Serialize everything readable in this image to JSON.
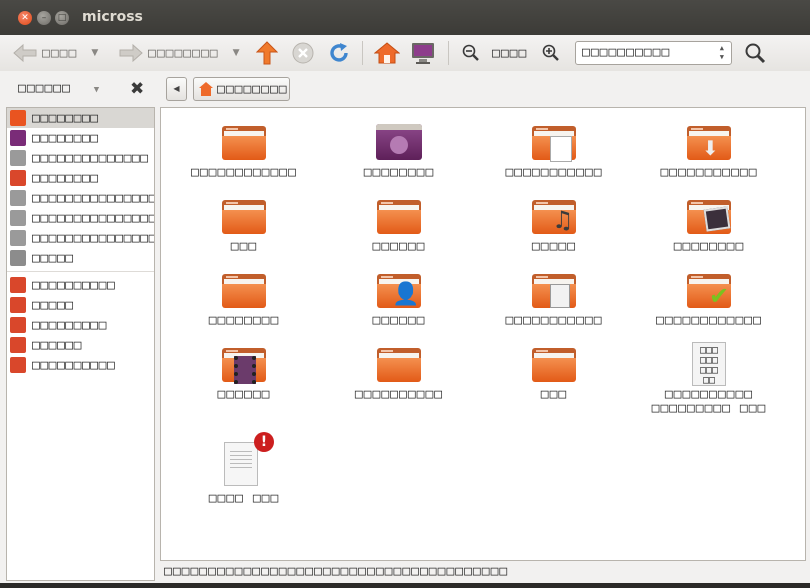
{
  "window": {
    "title": "micross"
  },
  "toolbar": {
    "back_label": "□□□□",
    "forward_label": "□□□□□□□□",
    "zoom_value": "□□□□",
    "view_mode": "□□□□□□□□□□"
  },
  "location": {
    "pane_label": "□□□□□□",
    "breadcrumb_label": "□□□□□□□□"
  },
  "sidebar": {
    "items": [
      {
        "label": "□□□□□□□□",
        "icon": "home-icon",
        "color": "#e95420"
      },
      {
        "label": "□□□□□□□□",
        "icon": "desktop-icon",
        "color": "#7a2c78"
      },
      {
        "label": "□□□□□□□□□□□□□□",
        "icon": "drive-icon",
        "color": "#9a9a9a"
      },
      {
        "label": "□□□□□□□□",
        "icon": "camera-icon",
        "color": "#d9472b"
      },
      {
        "label": "□□□□□□□□□□□□□□□",
        "icon": "drive-icon",
        "color": "#9a9a9a"
      },
      {
        "label": "□□□□□□□□□□□□□□□",
        "icon": "drive-icon",
        "color": "#9a9a9a"
      },
      {
        "label": "□□□□□□□□□□□□□□□",
        "icon": "drive-icon",
        "color": "#9a9a9a"
      },
      {
        "label": "□□□□□",
        "icon": "trash-icon",
        "color": "#8c8c8c"
      }
    ],
    "bookmarks": [
      {
        "label": "□□□□□□□□□□",
        "icon": "documents-icon",
        "color": "#d9472b"
      },
      {
        "label": "□□□□□",
        "icon": "music-icon",
        "color": "#d9472b"
      },
      {
        "label": "□□□□□□□□□",
        "icon": "pictures-icon",
        "color": "#d9472b"
      },
      {
        "label": "□□□□□□",
        "icon": "videos-icon",
        "color": "#d9472b"
      },
      {
        "label": "□□□□□□□□□□",
        "icon": "downloads-icon",
        "color": "#d9472b"
      }
    ]
  },
  "files": [
    {
      "label": "□□□□□□□□□□□□",
      "icon": "folder-icon"
    },
    {
      "label": "□□□□□□□□",
      "icon": "desktop-folder-icon"
    },
    {
      "label": "□□□□□□□□□□□",
      "icon": "documents-folder-icon"
    },
    {
      "label": "□□□□□□□□□□□",
      "icon": "downloads-folder-icon"
    },
    {
      "label": "□□□",
      "icon": "folder-icon"
    },
    {
      "label": "□□□□□□",
      "icon": "folder-icon"
    },
    {
      "label": "□□□□□",
      "icon": "music-folder-icon"
    },
    {
      "label": "□□□□□□□□",
      "icon": "pictures-folder-icon"
    },
    {
      "label": "□□□□□□□□",
      "icon": "folder-icon"
    },
    {
      "label": "□□□□□□",
      "icon": "public-folder-icon"
    },
    {
      "label": "□□□□□□□□□□□",
      "icon": "templates-folder-icon"
    },
    {
      "label": "□□□□□□□□□□□□",
      "icon": "shared-folder-icon"
    },
    {
      "label": "□□□□□□",
      "icon": "videos-folder-icon"
    },
    {
      "label": "□□□□□□□□□□",
      "icon": "folder-icon"
    },
    {
      "label": "□□□",
      "icon": "folder-icon"
    },
    {
      "label": "□□□□□□□□□□",
      "label2": "□□□□□□□□□  □□□",
      "icon": "text-file-icon"
    },
    {
      "label": "□□□□  □□□",
      "icon": "broken-file-icon"
    }
  ],
  "status": {
    "text": "□□□□□□□□□□□□□□□□□□□□□□□□□□□□□□□□□□□□□□□"
  },
  "colors": {
    "accent": "#e95420",
    "titlebar": "#3c3b37"
  }
}
